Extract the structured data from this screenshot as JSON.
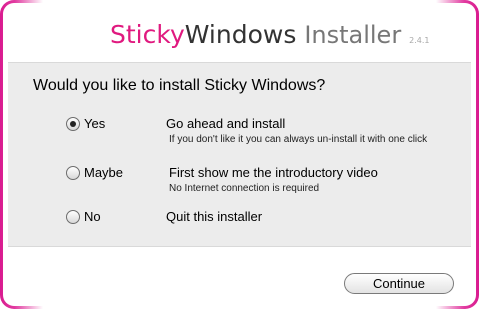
{
  "header": {
    "title_sticky": "Sticky",
    "title_windows": "Windows",
    "title_installer": "Installer",
    "version": "2.4.1"
  },
  "question": "Would you like to install Sticky Windows?",
  "options": [
    {
      "label": "Yes",
      "selected": true,
      "description": "Go ahead and install",
      "subtext": "If you don't like it you can always un-install it with one click"
    },
    {
      "label": "Maybe",
      "selected": false,
      "description": "First show me the introductory video",
      "subtext": "No Internet connection is required"
    },
    {
      "label": "No",
      "selected": false,
      "description": "Quit this installer",
      "subtext": ""
    }
  ],
  "footer": {
    "continue_label": "Continue"
  },
  "colors": {
    "brand": "#e0197f",
    "panel": "#ececec"
  }
}
